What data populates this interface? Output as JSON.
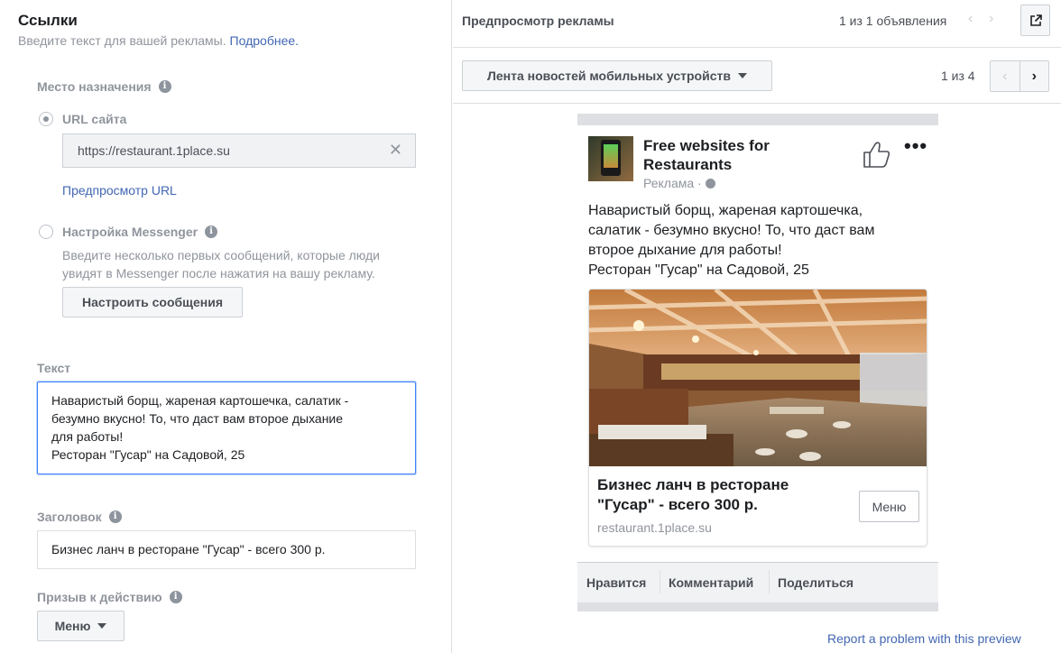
{
  "links_section": {
    "title": "Ссылки",
    "subtitle": "Введите текст для вашей рекламы.",
    "more_link": "Подробнее."
  },
  "destination": {
    "label": "Место назначения",
    "website": {
      "label": "URL сайта",
      "selected": true,
      "url_value": "https://restaurant.1place.su",
      "preview_url_link": "Предпросмотр URL"
    },
    "messenger": {
      "label": "Настройка Messenger",
      "selected": false,
      "description": "Введите несколько первых сообщений, которые люди увидят в Messenger после нажатия на вашу рекламу.",
      "button_label": "Настроить сообщения"
    }
  },
  "text_field": {
    "label": "Текст",
    "value": "Наваристый борщ, жареная картошечка, салатик -\nбезумно вкусно! То, что даст вам второе дыхание\nдля работы!\nРесторан \"Гусар\" на Садовой, 25"
  },
  "headline_field": {
    "label": "Заголовок",
    "value": "Бизнес ланч в ресторане \"Гусар\"  - всего 300 р."
  },
  "cta_field": {
    "label": "Призыв к действию",
    "selected": "Меню"
  },
  "preview": {
    "title": "Предпросмотр рекламы",
    "ad_count": "1 из 1 объявления",
    "placement": "Лента новостей мобильных устройств",
    "placement_count": "1 из 4",
    "report_link": "Report a problem with this preview"
  },
  "ad": {
    "page_name": "Free websites for Restaurants",
    "sponsored": "Реклама ·",
    "body": "Наваристый борщ, жареная картошечка,\nсалатик - безумно вкусно! То, что даст вам\nвторое дыхание для работы!\nРесторан \"Гусар\" на Садовой, 25",
    "card_title": "Бизнес ланч в ресторане \"Гусар\" - всего 300 р.",
    "card_domain": "restaurant.1place.su",
    "card_button": "Меню",
    "actions": [
      "Нравится",
      "Комментарий",
      "Поделиться"
    ]
  },
  "colors": {
    "link": "#4267b2",
    "focus_border": "#4080ff",
    "muted_text": "#90949c"
  }
}
